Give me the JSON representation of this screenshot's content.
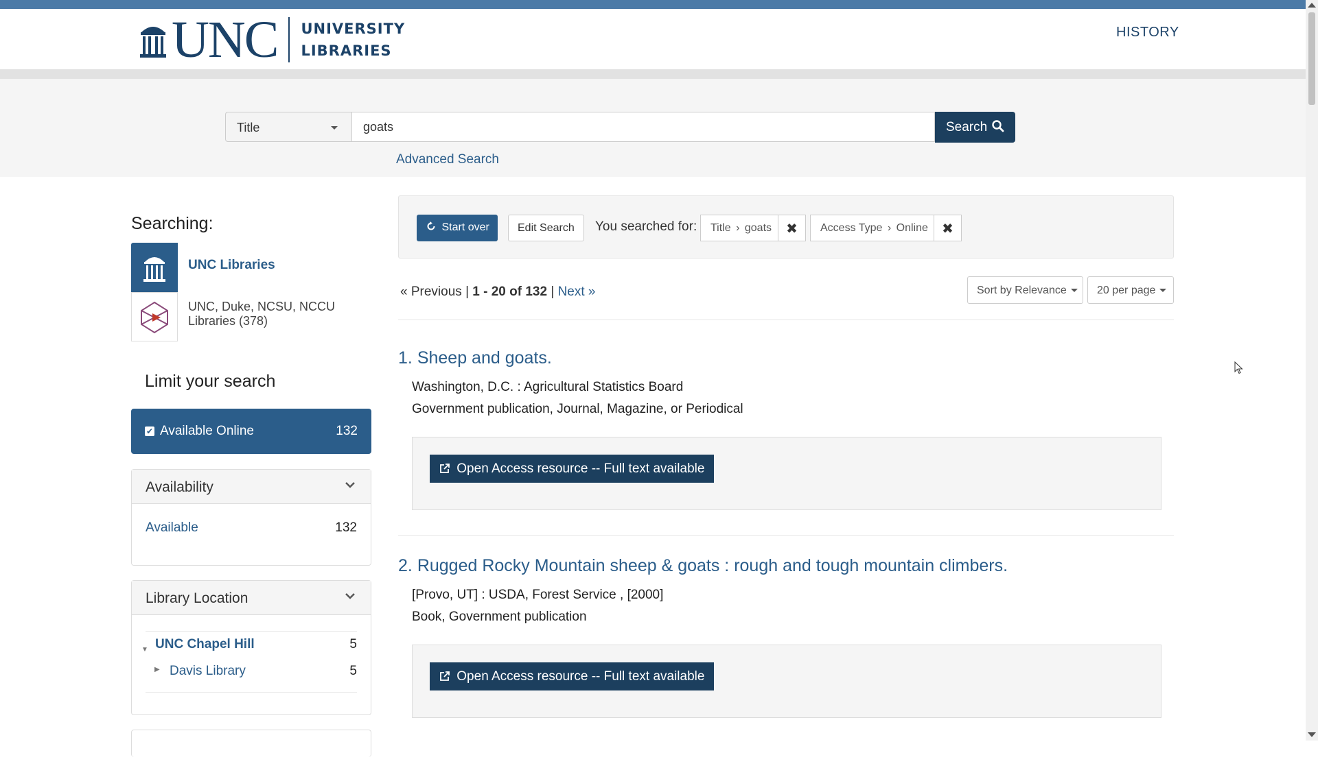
{
  "header": {
    "logo_text": "UNC",
    "logo_sub_line1": "UNIVERSITY",
    "logo_sub_line2": "LIBRARIES",
    "history_label": "HISTORY"
  },
  "search": {
    "field_label": "Title",
    "query_value": "goats",
    "search_button": "Search",
    "advanced_link": "Advanced Search"
  },
  "sidebar": {
    "searching_label": "Searching:",
    "sources": [
      {
        "label": "UNC Libraries"
      },
      {
        "label": "UNC, Duke, NCSU, NCCU Libraries (378)"
      }
    ],
    "limit_title": "Limit your search",
    "online_facet": {
      "label": "Available Online",
      "count": "132"
    },
    "availability": {
      "title": "Availability",
      "items": [
        {
          "label": "Available",
          "count": "132"
        }
      ]
    },
    "library_location": {
      "title": "Library Location",
      "items": [
        {
          "label": "UNC Chapel Hill",
          "count": "5"
        },
        {
          "label": "Davis Library",
          "count": "5"
        }
      ]
    }
  },
  "constraints": {
    "start_over": "Start over",
    "edit_search": "Edit Search",
    "you_searched_for": "You searched for:",
    "chips": [
      {
        "field": "Title",
        "value": "goats"
      },
      {
        "field": "Access Type",
        "value": "Online"
      }
    ]
  },
  "pagination": {
    "previous": "« Previous",
    "separator": "|",
    "range": "1 - 20 of 132",
    "next": "Next »",
    "sort_label": "Sort by Relevance",
    "per_page_label": "20 per page"
  },
  "results": [
    {
      "number": "1.",
      "title": "Sheep and goats.",
      "publisher": "Washington, D.C. : Agricultural Statistics Board",
      "format": "Government publication, Journal, Magazine, or Periodical",
      "access_label": "Open Access resource -- Full text available"
    },
    {
      "number": "2.",
      "title": "Rugged Rocky Mountain sheep & goats : rough and tough mountain climbers.",
      "publisher": "[Provo, UT] : USDA, Forest Service , [2000]",
      "format": "Book, Government publication",
      "access_label": "Open Access resource -- Full text available"
    }
  ],
  "colors": {
    "brand_navy": "#1c3f5e",
    "link_blue": "#2b5d8a",
    "top_stripe": "#4b7aa7"
  }
}
